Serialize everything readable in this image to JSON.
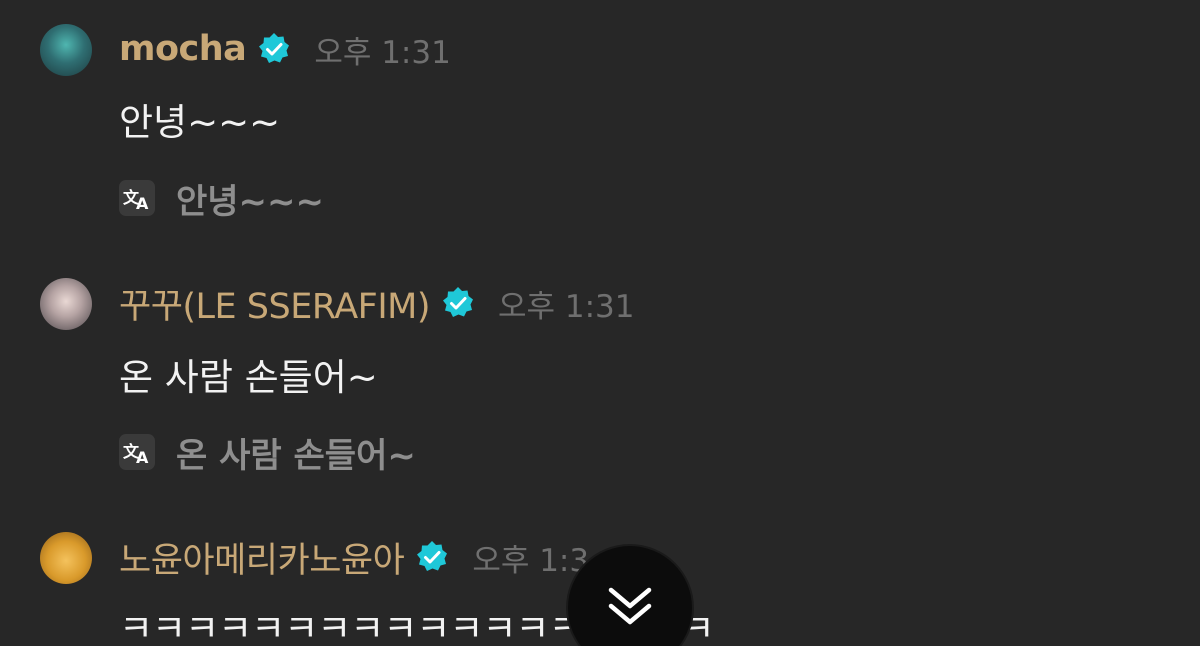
{
  "messages": [
    {
      "username": "mocha",
      "timestamp": "오후 1:31",
      "text": "안녕~~~",
      "translation": "안녕~~~",
      "verified": true
    },
    {
      "username": "꾸꾸(LE SSERAFIM)",
      "timestamp": "오후 1:31",
      "text": "온 사람 손들어~",
      "translation": "온 사람 손들어~",
      "verified": true
    },
    {
      "username": "노윤아메리카노윤아",
      "timestamp": "오후 1:3",
      "text": "ㅋㅋㅋㅋㅋㅋㅋㅋㅋㅋㅋㅋㅋㅋㅋㅋㅋㅋ",
      "verified": true
    }
  ],
  "icons": {
    "verified": "verified-badge-icon",
    "translate": "translate-icon",
    "scroll_down": "double-chevron-down-icon"
  },
  "colors": {
    "background": "#272727",
    "username": "#c8a877",
    "verified_badge": "#1fc8d8",
    "timestamp": "#6f6f6f",
    "message_text": "#f2f2f2",
    "translation_text": "#8e8e8e"
  }
}
